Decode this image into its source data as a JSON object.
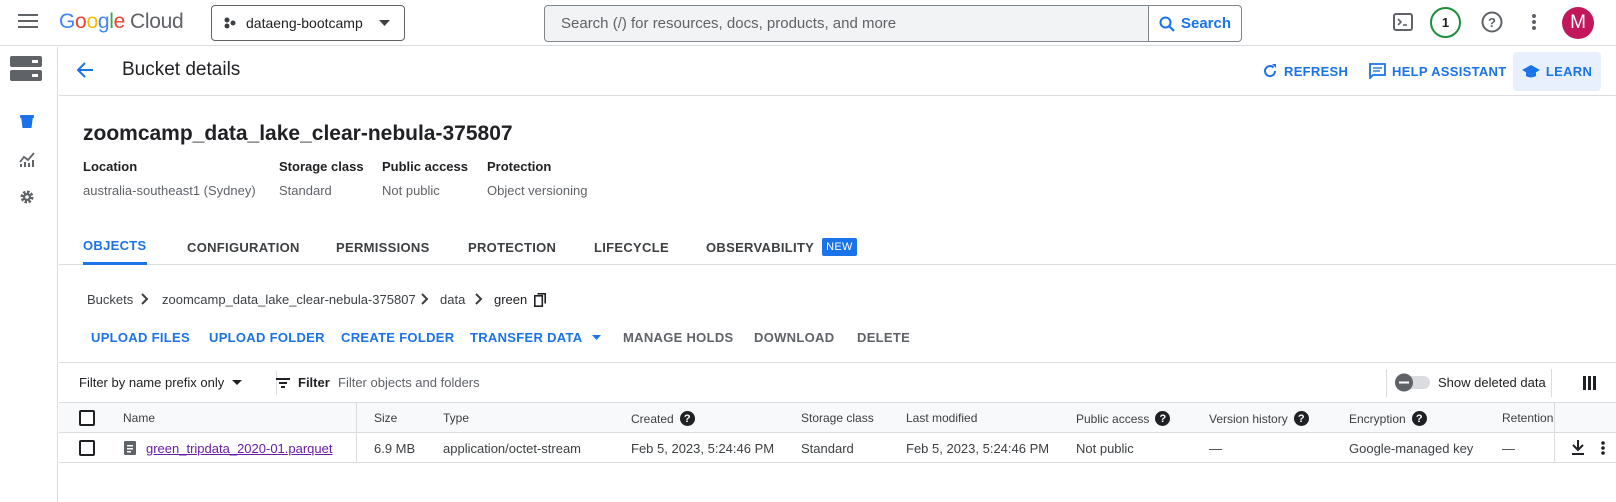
{
  "topbar": {
    "logo_google": "Google",
    "logo_cloud": "Cloud",
    "project": "dataeng-bootcamp",
    "search_placeholder": "Search (/) for resources, docs, products, and more",
    "search_button": "Search",
    "notification_count": "1",
    "avatar_letter": "M"
  },
  "header": {
    "title": "Bucket details",
    "refresh": "REFRESH",
    "help_assistant": "HELP ASSISTANT",
    "learn": "LEARN"
  },
  "bucket": {
    "name": "zoomcamp_data_lake_clear-nebula-375807",
    "meta": [
      {
        "label": "Location",
        "value": "australia-southeast1 (Sydney)"
      },
      {
        "label": "Storage class",
        "value": "Standard"
      },
      {
        "label": "Public access",
        "value": "Not public"
      },
      {
        "label": "Protection",
        "value": "Object versioning"
      }
    ]
  },
  "tabs": [
    {
      "label": "OBJECTS"
    },
    {
      "label": "CONFIGURATION"
    },
    {
      "label": "PERMISSIONS"
    },
    {
      "label": "PROTECTION"
    },
    {
      "label": "LIFECYCLE"
    },
    {
      "label": "OBSERVABILITY",
      "badge": "NEW"
    }
  ],
  "breadcrumb": [
    "Buckets",
    "zoomcamp_data_lake_clear-nebula-375807",
    "data",
    "green"
  ],
  "actions": [
    "UPLOAD FILES",
    "UPLOAD FOLDER",
    "CREATE FOLDER",
    "TRANSFER DATA",
    "MANAGE HOLDS",
    "DOWNLOAD",
    "DELETE"
  ],
  "filterbar": {
    "prefix": "Filter by name prefix only",
    "filter": "Filter",
    "placeholder": "Filter objects and folders",
    "show_deleted": "Show deleted data"
  },
  "table": {
    "columns": [
      "Name",
      "Size",
      "Type",
      "Created",
      "Storage class",
      "Last modified",
      "Public access",
      "Version history",
      "Encryption",
      "Retention"
    ],
    "rows": [
      {
        "name": "green_tripdata_2020-01.parquet",
        "size": "6.9 MB",
        "type": "application/octet-stream",
        "created": "Feb 5, 2023, 5:24:46 PM",
        "storage_class": "Standard",
        "last_modified": "Feb 5, 2023, 5:24:46 PM",
        "public_access": "Not public",
        "version_history": "—",
        "encryption": "Google-managed key",
        "retention": "—"
      }
    ]
  },
  "colors": {
    "accent": "#1a73e8",
    "avatar": "#c2185b",
    "notification": "#1e8e3e",
    "link_visited": "#681da8"
  }
}
